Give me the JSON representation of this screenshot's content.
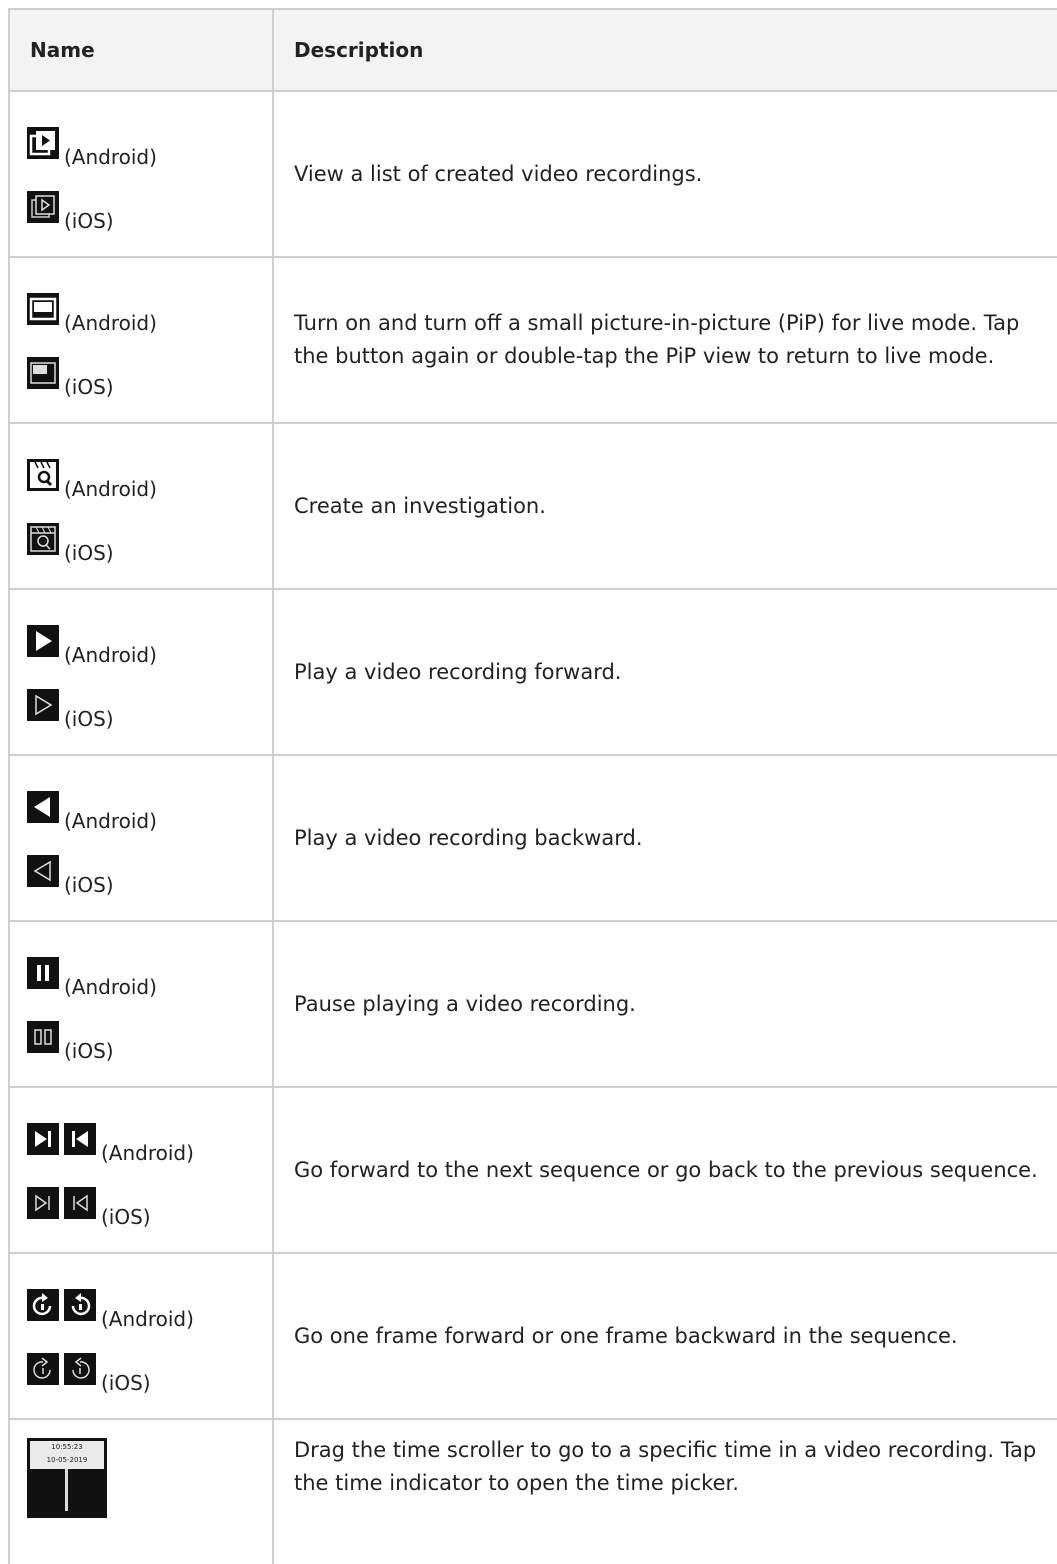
{
  "header": {
    "name": "Name",
    "description": "Description"
  },
  "rows": [
    {
      "android": "(Android)",
      "ios": "(iOS)",
      "description": "View a list of created video recordings.",
      "android_icons": [
        "recordings-list-icon"
      ],
      "ios_icons": [
        "recordings-list-outline-icon"
      ]
    },
    {
      "android": "(Android)",
      "ios": "(iOS)",
      "description": "Turn on and turn off a small picture-in-picture (PiP) for live mode. Tap the button again or double-tap the PiP view to return to live mode.",
      "android_icons": [
        "picture-in-picture-icon"
      ],
      "ios_icons": [
        "picture-in-picture-outline-icon"
      ]
    },
    {
      "android": "(Android)",
      "ios": "(iOS)",
      "description": "Create an investigation.",
      "android_icons": [
        "investigation-icon"
      ],
      "ios_icons": [
        "investigation-outline-icon"
      ]
    },
    {
      "android": "(Android)",
      "ios": "(iOS)",
      "description": "Play a video recording forward.",
      "android_icons": [
        "play-forward-icon"
      ],
      "ios_icons": [
        "play-forward-outline-icon"
      ]
    },
    {
      "android": "(Android)",
      "ios": "(iOS)",
      "description": "Play a video recording backward.",
      "android_icons": [
        "play-backward-icon"
      ],
      "ios_icons": [
        "play-backward-outline-icon"
      ]
    },
    {
      "android": "(Android)",
      "ios": "(iOS)",
      "description": "Pause playing a video recording.",
      "android_icons": [
        "pause-icon"
      ],
      "ios_icons": [
        "pause-outline-icon"
      ]
    },
    {
      "android": "(Android)",
      "ios": "(iOS)",
      "description": "Go forward to the next sequence or go back to the previous sequence.",
      "android_icons": [
        "next-sequence-icon",
        "previous-sequence-icon"
      ],
      "ios_icons": [
        "next-sequence-outline-icon",
        "previous-sequence-outline-icon"
      ]
    },
    {
      "android": "(Android)",
      "ios": "(iOS)",
      "description": "Go one frame forward or one frame backward in the sequence.",
      "android_icons": [
        "frame-forward-icon",
        "frame-backward-icon"
      ],
      "ios_icons": [
        "frame-forward-outline-icon",
        "frame-backward-outline-icon"
      ]
    },
    {
      "description": "Drag the time scroller to go to a specific time in a video recording. Tap the time indicator to open the time picker.",
      "scroller_time": "10:55:23",
      "scroller_date": "10-05-2019",
      "icon": "time-scroller-icon"
    }
  ]
}
